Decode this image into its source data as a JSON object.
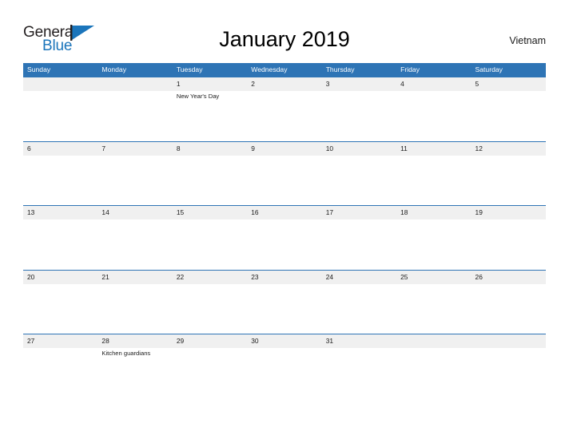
{
  "brand": {
    "word_one": "General",
    "word_two": "Blue",
    "flag_icon": "blue-triangle-flag-icon",
    "color_dark": "#231f20",
    "color_blue": "#1b75bb"
  },
  "header": {
    "title": "January 2019",
    "country": "Vietnam"
  },
  "theme": {
    "header_blue": "#2e74b5",
    "band_gray": "#f0f0f0",
    "page_background": "#ffffff",
    "text_color": "#1a1a1a"
  },
  "calendar": {
    "month": "January",
    "year": "2019",
    "weekday_headers": [
      "Sunday",
      "Monday",
      "Tuesday",
      "Wednesday",
      "Thursday",
      "Friday",
      "Saturday"
    ],
    "weeks": [
      {
        "days": [
          {
            "number": "",
            "events": []
          },
          {
            "number": "",
            "events": []
          },
          {
            "number": "1",
            "events": [
              "New Year's Day"
            ]
          },
          {
            "number": "2",
            "events": []
          },
          {
            "number": "3",
            "events": []
          },
          {
            "number": "4",
            "events": []
          },
          {
            "number": "5",
            "events": []
          }
        ]
      },
      {
        "days": [
          {
            "number": "6",
            "events": []
          },
          {
            "number": "7",
            "events": []
          },
          {
            "number": "8",
            "events": []
          },
          {
            "number": "9",
            "events": []
          },
          {
            "number": "10",
            "events": []
          },
          {
            "number": "11",
            "events": []
          },
          {
            "number": "12",
            "events": []
          }
        ]
      },
      {
        "days": [
          {
            "number": "13",
            "events": []
          },
          {
            "number": "14",
            "events": []
          },
          {
            "number": "15",
            "events": []
          },
          {
            "number": "16",
            "events": []
          },
          {
            "number": "17",
            "events": []
          },
          {
            "number": "18",
            "events": []
          },
          {
            "number": "19",
            "events": []
          }
        ]
      },
      {
        "days": [
          {
            "number": "20",
            "events": []
          },
          {
            "number": "21",
            "events": []
          },
          {
            "number": "22",
            "events": []
          },
          {
            "number": "23",
            "events": []
          },
          {
            "number": "24",
            "events": []
          },
          {
            "number": "25",
            "events": []
          },
          {
            "number": "26",
            "events": []
          }
        ]
      },
      {
        "days": [
          {
            "number": "27",
            "events": []
          },
          {
            "number": "28",
            "events": [
              "Kitchen guardians"
            ]
          },
          {
            "number": "29",
            "events": []
          },
          {
            "number": "30",
            "events": []
          },
          {
            "number": "31",
            "events": []
          },
          {
            "number": "",
            "events": []
          },
          {
            "number": "",
            "events": []
          }
        ]
      }
    ]
  }
}
